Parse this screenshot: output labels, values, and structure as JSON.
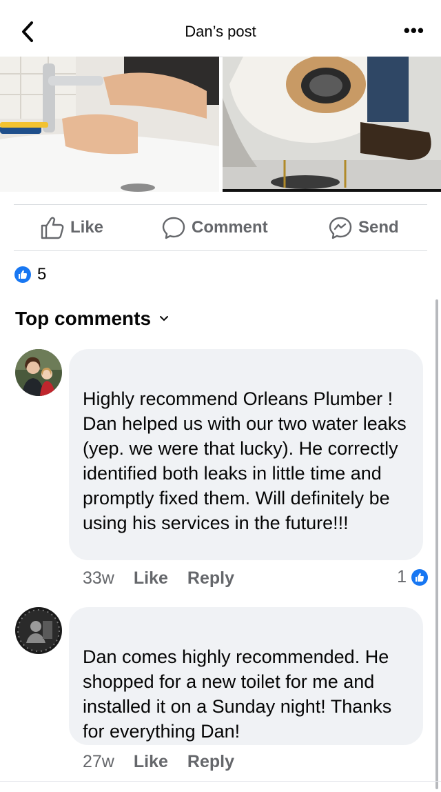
{
  "header": {
    "title": "Dan’s post"
  },
  "actions": {
    "like": "Like",
    "comment": "Comment",
    "send": "Send"
  },
  "reactions": {
    "count": "5"
  },
  "comments_header": "Top comments",
  "comments": [
    {
      "author": "",
      "text": "Highly recommend Orleans Plumber ! Dan helped us with our two water leaks (yep. we were that lucky). He correctly identified both leaks in little time and promptly fixed them. Will definitely be using his services in the future!!!",
      "time": "33w",
      "like": "Like",
      "reply": "Reply",
      "reaction_count": "1"
    },
    {
      "author": "",
      "text": "Dan comes highly recommended. He shopped for a new toilet for me and installed it on a Sunday night! Thanks for everything Dan!",
      "time": "27w",
      "like": "Like",
      "reply": "Reply"
    }
  ],
  "colors": {
    "accent": "#1877f2",
    "secondary_text": "#65676b",
    "bubble": "#f0f2f5"
  }
}
